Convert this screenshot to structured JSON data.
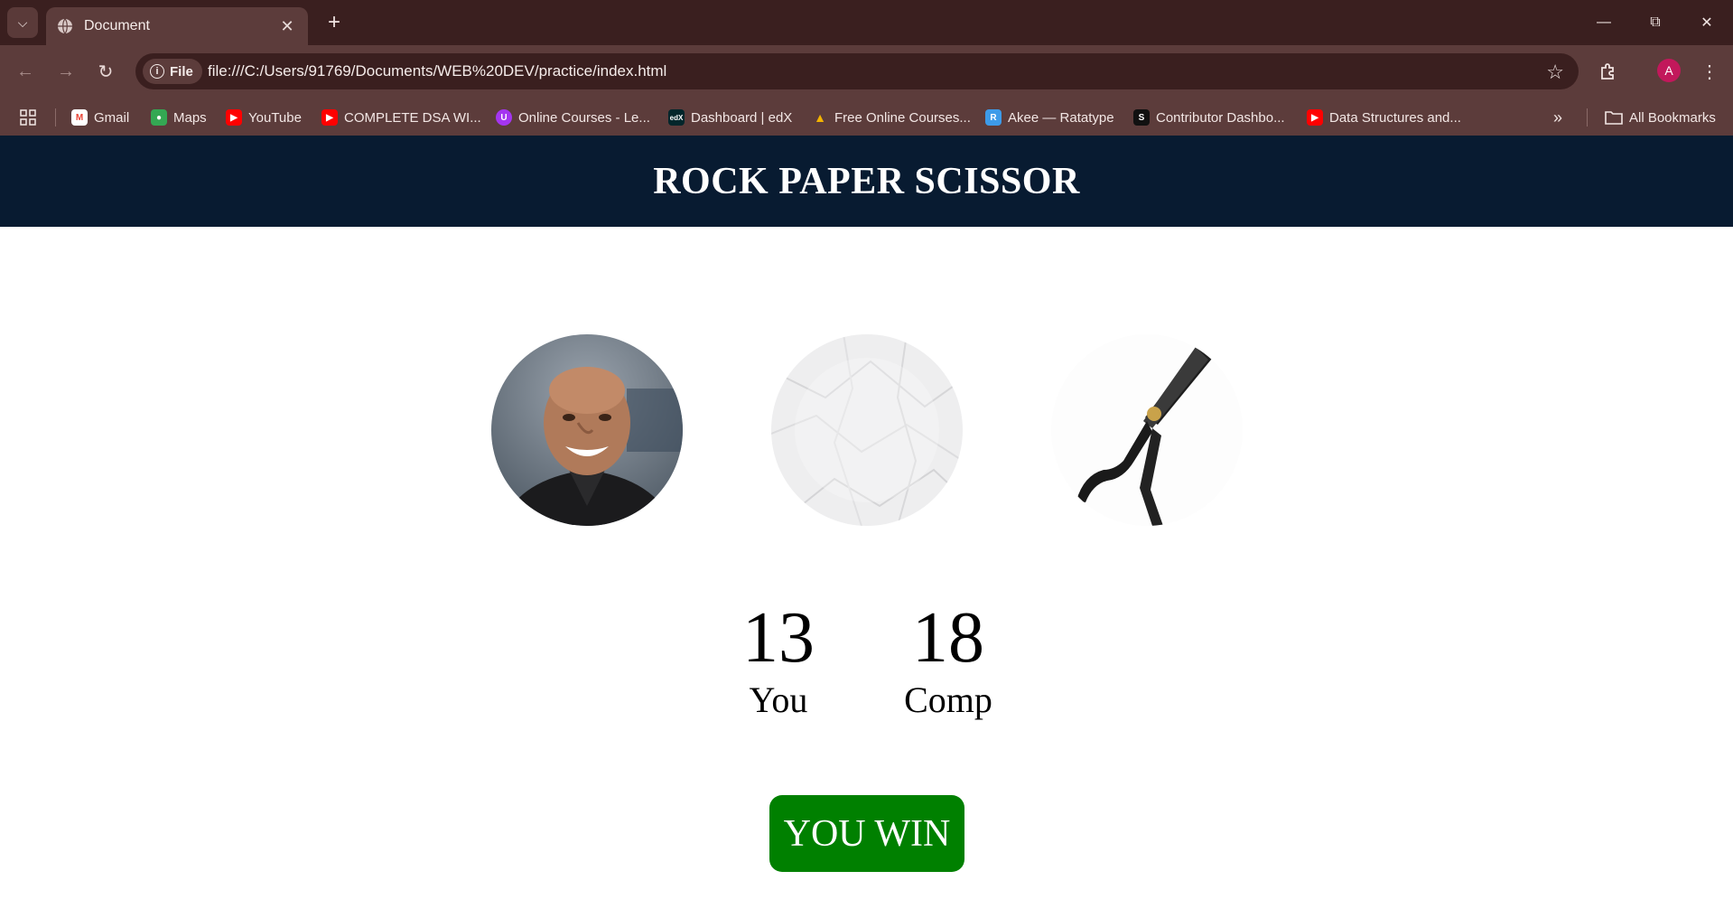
{
  "browser": {
    "tab_title": "Document",
    "url": "file:///C:/Users/91769/Documents/WEB%20DEV/practice/index.html",
    "site_chip": "File",
    "avatar_letter": "A",
    "bookmarks": [
      {
        "label": "Gmail",
        "icon": "gmail-icon",
        "color": "#ea4335"
      },
      {
        "label": "Maps",
        "icon": "maps-icon",
        "color": "#34a853"
      },
      {
        "label": "YouTube",
        "icon": "youtube-icon",
        "color": "#ff0000"
      },
      {
        "label": "COMPLETE DSA WI...",
        "icon": "youtube-icon",
        "color": "#ff0000"
      },
      {
        "label": "Online Courses - Le...",
        "icon": "udemy-icon",
        "color": "#a435f0"
      },
      {
        "label": "Dashboard | edX",
        "icon": "edx-icon",
        "color": "#02262b"
      },
      {
        "label": "Free Online Courses...",
        "icon": "coursera-icon",
        "color": "#f4b400"
      },
      {
        "label": "Akee — Ratatype",
        "icon": "ratatype-icon",
        "color": "#3d9be9"
      },
      {
        "label": "Contributor Dashbo...",
        "icon": "contributor-icon",
        "color": "#111111"
      },
      {
        "label": "Data Structures and...",
        "icon": "youtube-icon",
        "color": "#ff0000"
      }
    ],
    "all_bookmarks": "All Bookmarks"
  },
  "game": {
    "title": "ROCK PAPER SCISSOR",
    "choices": [
      {
        "name": "rock",
        "icon": "rock-image"
      },
      {
        "name": "paper",
        "icon": "paper-image"
      },
      {
        "name": "scissors",
        "icon": "scissors-image"
      }
    ],
    "score": {
      "user_score": "13",
      "user_label": "You",
      "comp_score": "18",
      "comp_label": "Comp"
    },
    "message": "YOU WIN",
    "message_color": "#008000",
    "header_color": "#081b31"
  }
}
